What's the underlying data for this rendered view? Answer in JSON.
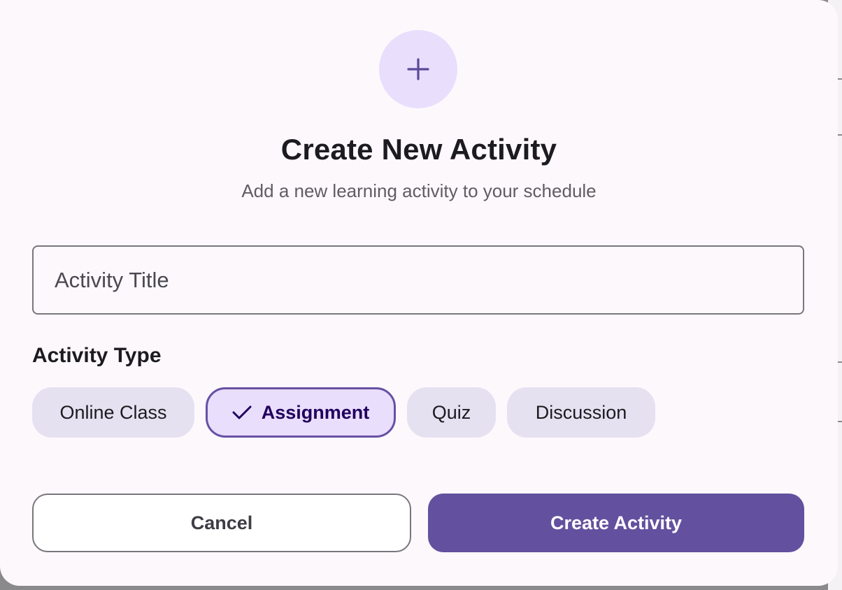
{
  "dialog": {
    "icon": "plus-icon",
    "title": "Create New Activity",
    "subtitle": "Add a new learning activity to your schedule"
  },
  "form": {
    "title_field": {
      "placeholder": "Activity Title",
      "value": ""
    },
    "type_section_label": "Activity Type",
    "activity_types": [
      {
        "label": "Online Class",
        "selected": false
      },
      {
        "label": "Assignment",
        "selected": true
      },
      {
        "label": "Quiz",
        "selected": false
      },
      {
        "label": "Discussion",
        "selected": false
      }
    ]
  },
  "actions": {
    "cancel_label": "Cancel",
    "create_label": "Create Activity"
  },
  "colors": {
    "accent": "#63509e",
    "accent_container": "#e9defc",
    "chip_background": "#e6e1f1",
    "surface": "#fdf8fc"
  }
}
